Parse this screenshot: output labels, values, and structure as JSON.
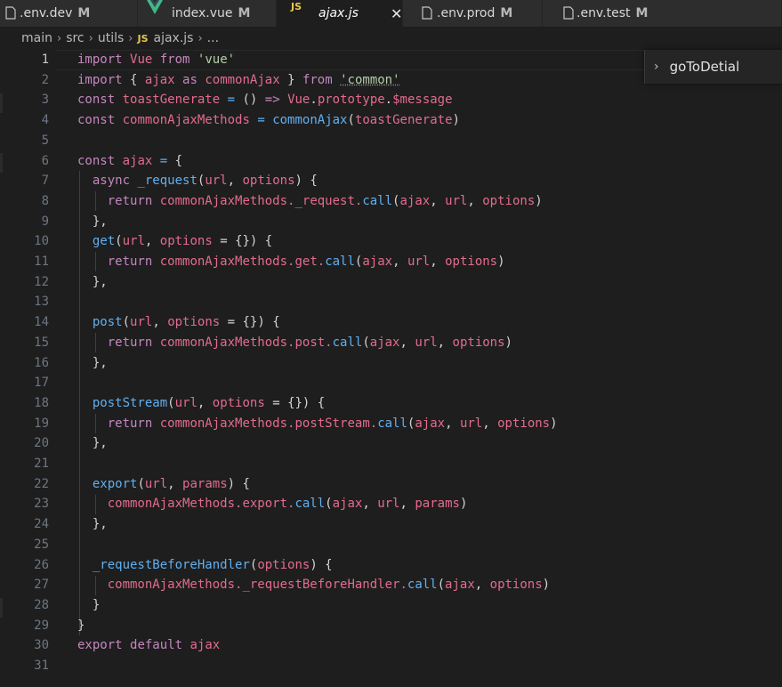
{
  "tabs": [
    {
      "name": ".env.dev",
      "mod": "M",
      "type": "file"
    },
    {
      "name": "index.vue",
      "mod": "M",
      "type": "vue"
    },
    {
      "name": "ajax.js",
      "mod": "",
      "type": "js",
      "close": "✕"
    },
    {
      "name": ".env.prod",
      "mod": "M",
      "type": "file"
    },
    {
      "name": ".env.test",
      "mod": "M",
      "type": "file"
    }
  ],
  "breadcrumb": {
    "parts": [
      "main",
      "src",
      "utils"
    ],
    "js_badge": "JS",
    "file": "ajax.js",
    "tail": "...",
    "sep": "›"
  },
  "outline_widget": {
    "chevron": "›",
    "label": "goToDetial"
  },
  "line_numbers": [
    "1",
    "2",
    "3",
    "4",
    "5",
    "6",
    "7",
    "8",
    "9",
    "10",
    "11",
    "12",
    "13",
    "14",
    "15",
    "16",
    "17",
    "18",
    "19",
    "20",
    "21",
    "22",
    "23",
    "24",
    "25",
    "26",
    "27",
    "28",
    "29",
    "30",
    "31"
  ],
  "current_line": 1,
  "code": {
    "l1": [
      "import",
      "Vue",
      "from",
      "'vue'"
    ],
    "l2": [
      "import",
      "{",
      "ajax",
      "as",
      "commonAjax",
      "}",
      "from",
      "'common'"
    ],
    "l3": [
      "const",
      "toastGenerate",
      "=",
      "()",
      "=>",
      "Vue",
      ".",
      "prototype",
      ".",
      "$message"
    ],
    "l4": [
      "const",
      "commonAjaxMethods",
      "=",
      "commonAjax",
      "(",
      "toastGenerate",
      ")"
    ],
    "l6": [
      "const",
      "ajax",
      "=",
      "{"
    ],
    "l7": [
      "async",
      "_request",
      "(",
      "url",
      ",",
      "options",
      ") {"
    ],
    "l8": [
      "return",
      "commonAjaxMethods",
      "._request.",
      "call",
      "(",
      "ajax",
      ",",
      "url",
      ",",
      "options",
      ")"
    ],
    "l9": "},",
    "l10": [
      "get",
      "(",
      "url",
      ",",
      "options",
      "= {}) {"
    ],
    "l11": [
      "return",
      "commonAjaxMethods",
      ".get.",
      "call",
      "(",
      "ajax",
      ",",
      "url",
      ",",
      "options",
      ")"
    ],
    "l12": "},",
    "l14": [
      "post",
      "(",
      "url",
      ",",
      "options",
      "= {}) {"
    ],
    "l15": [
      "return",
      "commonAjaxMethods",
      ".post.",
      "call",
      "(",
      "ajax",
      ",",
      "url",
      ",",
      "options",
      ")"
    ],
    "l16": "},",
    "l18": [
      "postStream",
      "(",
      "url",
      ",",
      "options",
      "= {}) {"
    ],
    "l19": [
      "return",
      "commonAjaxMethods",
      ".postStream.",
      "call",
      "(",
      "ajax",
      ",",
      "url",
      ",",
      "options",
      ")"
    ],
    "l20": "},",
    "l22": [
      "export",
      "(",
      "url",
      ",",
      "params",
      ") {"
    ],
    "l23": [
      "commonAjaxMethods",
      ".export.",
      "call",
      "(",
      "ajax",
      ",",
      "url",
      ",",
      "params",
      ")"
    ],
    "l24": "},",
    "l26": [
      "_requestBeforeHandler",
      "(",
      "options",
      ") {"
    ],
    "l27": [
      "commonAjaxMethods",
      "._requestBeforeHandler.",
      "call",
      "(",
      "ajax",
      ",",
      "options",
      ")"
    ],
    "l28": "}",
    "l29": "}",
    "l30": [
      "export",
      "default",
      "ajax"
    ]
  }
}
